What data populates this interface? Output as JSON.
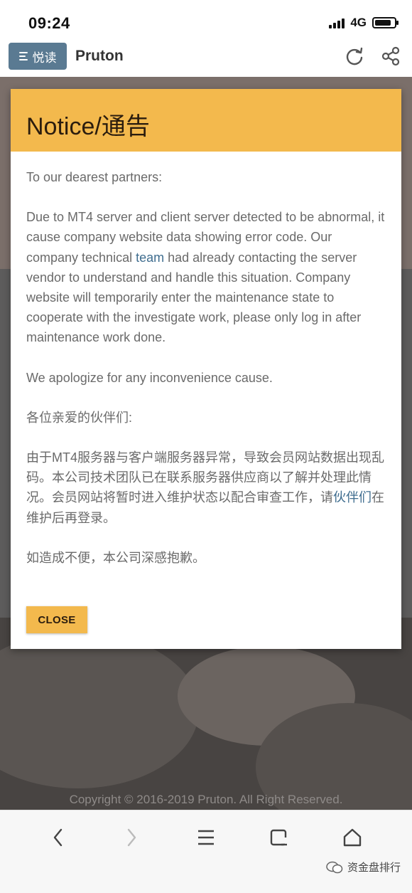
{
  "status_bar": {
    "time": "09:24",
    "network": "4G",
    "battery_level": 0.85
  },
  "app_bar": {
    "reader_label": "悦读",
    "site_title": "Pruton",
    "icons": [
      "refresh-icon",
      "share-icon"
    ]
  },
  "modal": {
    "title": "Notice/通告",
    "greeting_en": "To our dearest partners:",
    "body_en_1": "Due to MT4 server and client server detected to be abnormal, it cause company website data showing error code. Our company technical ",
    "body_en_link": "team",
    "body_en_2": " had already contacting the server vendor to understand and handle this situation. Company website will temporarily enter the maintenance state to cooperate with the investigate work, please only log in after maintenance work done.",
    "apology_en": "We apologize for any inconvenience cause.",
    "greeting_zh": "各位亲爱的伙伴们:",
    "body_zh_1": "由于MT4服务器与客户端服务器异常，导致会员网站数据出现乱码。本公司技术团队已在联系服务器供应商以了解并处理此情况。会员网站将暂时进入维护状态以配合审查工作，请",
    "body_zh_link": "伙伴们",
    "body_zh_2": "在维护后再登录。",
    "apology_zh": "如造成不便，本公司深感抱歉。",
    "close_label": "CLOSE"
  },
  "footer": {
    "copyright": "Copyright © 2016-2019 Pruton. All Right Reserved."
  },
  "bottom_bar": {
    "icons": [
      "back-icon",
      "forward-icon",
      "menu-icon",
      "tabs-icon",
      "home-icon"
    ],
    "watermark": "资金盘排行"
  },
  "colors": {
    "accent": "#f3b94d",
    "reader_button": "#5a7a92",
    "link": "#3f6d8f",
    "overlay_dim": "#5d5c5c"
  }
}
